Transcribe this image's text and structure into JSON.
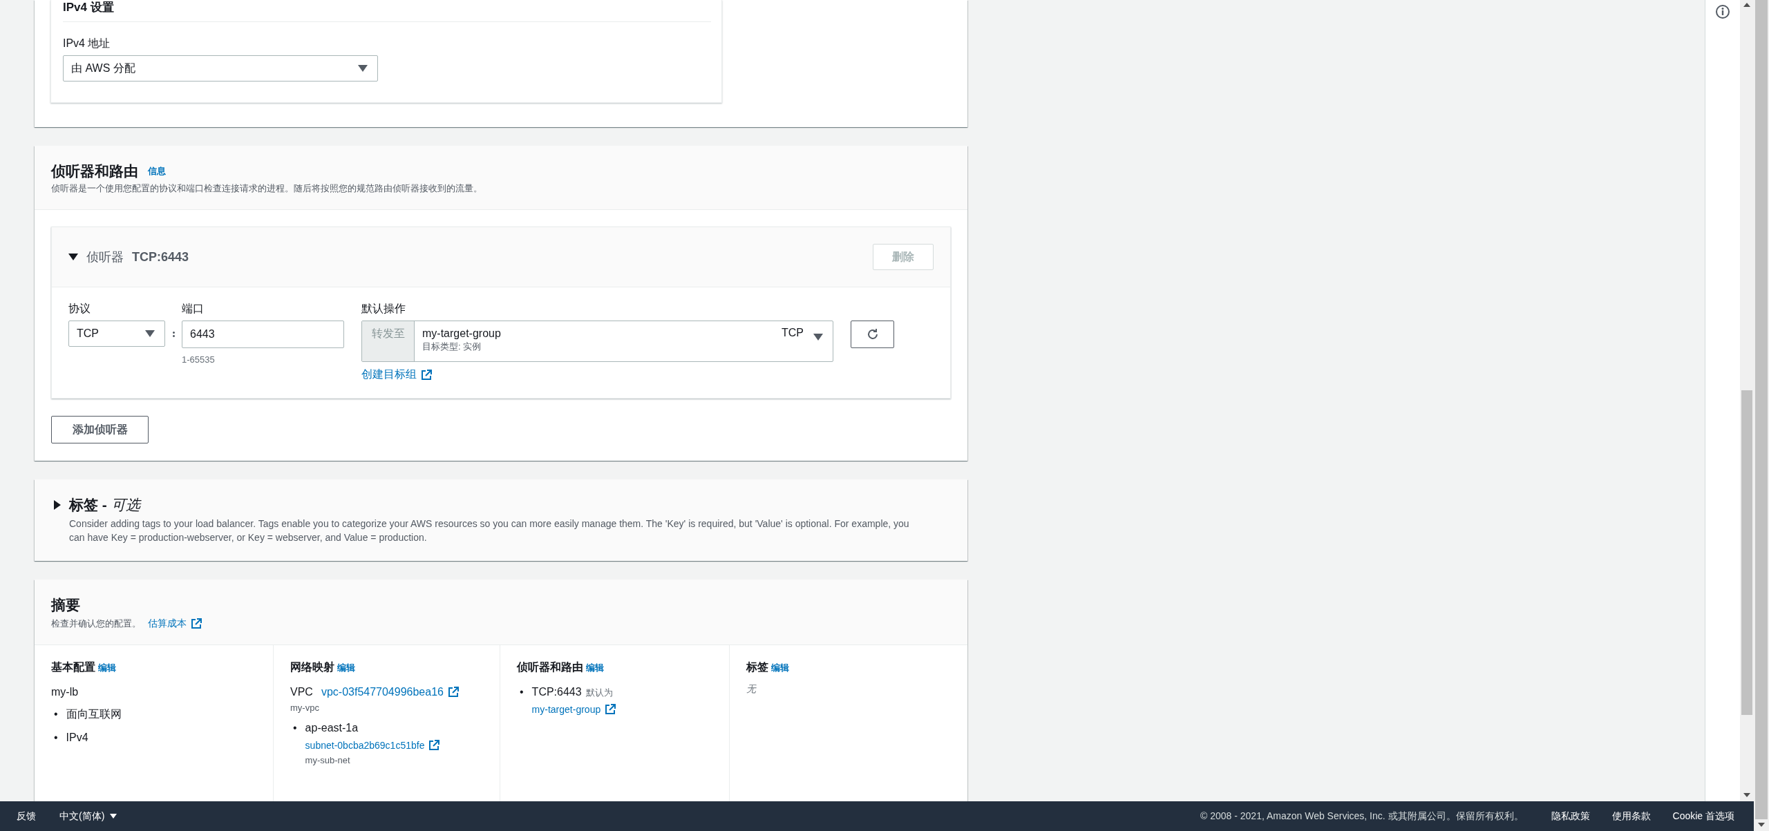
{
  "ipv4_settings": {
    "title": "IPv4 设置",
    "field_label": "IPv4 地址",
    "value": "由 AWS 分配"
  },
  "listeners_section": {
    "title": "侦听器和路由",
    "info_link": "信息",
    "description": "侦听器是一个使用您配置的协议和端口检查连接请求的进程。随后将按照您的规范路由侦听器接收到的流量。",
    "listeners": [
      {
        "expanded": true,
        "label": "侦听器",
        "name": "TCP:6443",
        "remove_button": {
          "label": "删除",
          "disabled": true
        },
        "protocol": {
          "label": "协议",
          "value": "TCP"
        },
        "port": {
          "label": "端口",
          "value": "6443",
          "hint": "1-65535"
        },
        "default_action": {
          "label": "默认操作",
          "prefix": "转发至",
          "target": "my-target-group",
          "target_type": "目标类型: 实例",
          "protocol": "TCP"
        },
        "create_link": "创建目标组"
      }
    ],
    "add_button": "添加侦听器"
  },
  "tags_section": {
    "expanded": false,
    "title": "**标签 -** *可选*",
    "description": "Consider adding tags to your load balancer. Tags enable you to categorize your AWS resources so you can more easily manage them. The 'Key' is required, but 'Value' is optional. For example, you can have Key = production-webserver, or Key = webserver, and Value = production."
  },
  "summary": {
    "title": "摘要",
    "description": "检查并确认您的配置。",
    "cost_link": "估算成本",
    "columns": [
      {
        "title": "基本配置",
        "edit": "编辑",
        "blocks": [
          {
            "kind": "text",
            "text": "my-lb"
          },
          {
            "kind": "bullets",
            "items": [
              {
                "marker": "•",
                "text": "面向互联网"
              },
              {
                "marker": "•",
                "text": "IPv4"
              }
            ]
          }
        ]
      },
      {
        "title": "网络映射",
        "edit": "编辑",
        "blocks": [
          {
            "kind": "labeled_link",
            "label": "VPC",
            "link": "vpc-03f547704996bea16",
            "sub": "my-vpc"
          },
          {
            "kind": "bullets",
            "items": [
              {
                "marker": "•",
                "text": "ap-east-1a",
                "link": "subnet-0bcba2b69c1c51bfe",
                "sub": "my-sub-net"
              }
            ]
          }
        ]
      },
      {
        "title": "侦听器和路由",
        "edit": "编辑",
        "blocks": [
          {
            "kind": "bullets",
            "items": [
              {
                "marker": "•",
                "text": "TCP:6443",
                "note": "默认为",
                "link": "my-target-group"
              }
            ]
          }
        ]
      },
      {
        "title": "标签",
        "edit": "编辑",
        "blocks": [
          {
            "kind": "empty",
            "text": "无"
          }
        ]
      }
    ]
  },
  "footer": {
    "feedback": "反馈",
    "language": "中文(简体)",
    "copyright": "© 2008 - 2021, Amazon Web Services, Inc. 或其附属公司。保留所有权利。",
    "links": [
      "隐私政策",
      "使用条款",
      "Cookie 首选项"
    ]
  }
}
